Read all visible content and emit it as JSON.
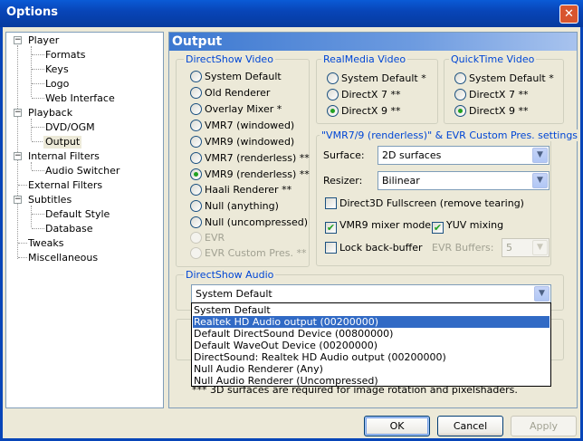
{
  "window": {
    "title": "Options",
    "close_glyph": "✕"
  },
  "tree": {
    "items": [
      {
        "label": "Player",
        "expanded": true
      },
      {
        "label": "Formats"
      },
      {
        "label": "Keys"
      },
      {
        "label": "Logo"
      },
      {
        "label": "Web Interface"
      },
      {
        "label": "Playback",
        "expanded": true
      },
      {
        "label": "DVD/OGM"
      },
      {
        "label": "Output",
        "selected": true
      },
      {
        "label": "Internal Filters",
        "expanded": true
      },
      {
        "label": "Audio Switcher"
      },
      {
        "label": "External Filters"
      },
      {
        "label": "Subtitles",
        "expanded": true
      },
      {
        "label": "Default Style"
      },
      {
        "label": "Database"
      },
      {
        "label": "Tweaks"
      },
      {
        "label": "Miscellaneous"
      }
    ],
    "expander_glyph": "−"
  },
  "panel": {
    "title": "Output"
  },
  "directshow_video": {
    "title": "DirectShow Video",
    "options": [
      "System Default",
      "Old Renderer",
      "Overlay Mixer *",
      "VMR7 (windowed)",
      "VMR9 (windowed)",
      "VMR7 (renderless) **",
      "VMR9 (renderless) **",
      "Haali Renderer **",
      "Null (anything)",
      "Null (uncompressed)",
      "EVR",
      "EVR Custom Pres. **"
    ],
    "selected": "VMR9 (renderless) **"
  },
  "realmedia_video": {
    "title": "RealMedia Video",
    "options": [
      "System Default *",
      "DirectX 7 **",
      "DirectX 9 **"
    ],
    "selected": "DirectX 9 **"
  },
  "quicktime_video": {
    "title": "QuickTime Video",
    "options": [
      "System Default *",
      "DirectX 7 **",
      "DirectX 9 **"
    ],
    "selected": "DirectX 9 **"
  },
  "vmr_settings": {
    "title": "\"VMR7/9 (renderless)\" & EVR Custom Pres. settings",
    "surface_label": "Surface:",
    "surface_value": "2D surfaces",
    "resizer_label": "Resizer:",
    "resizer_value": "Bilinear",
    "d3d_fullscreen_label": "Direct3D Fullscreen (remove tearing)",
    "d3d_fullscreen_checked": false,
    "vmr9_mixer_label": "VMR9 mixer mode",
    "vmr9_mixer_checked": true,
    "yuv_mixing_label": "YUV mixing",
    "yuv_mixing_checked": true,
    "lock_backbuffer_label": "Lock back-buffer",
    "lock_backbuffer_checked": false,
    "evr_buffers_label": "EVR Buffers:",
    "evr_buffers_value": "5"
  },
  "directshow_audio": {
    "title": "DirectShow Audio",
    "selected": "System Default",
    "options": [
      "System Default",
      "Realtek HD Audio output (00200000)",
      "Default DirectSound Device (00800000)",
      "Default WaveOut Device (00200000)",
      "DirectSound: Realtek HD Audio output (00200000)",
      "Null Audio Renderer (Any)",
      "Null Audio Renderer (Uncompressed)"
    ],
    "highlighted": "Realtek HD Audio output (00200000)"
  },
  "footnote": "*** 3D surfaces are required for image rotation and pixelshaders.",
  "buttons": {
    "ok": "OK",
    "cancel": "Cancel",
    "apply": "Apply"
  },
  "icons": {
    "combo_arrow": "▼",
    "check_mark": "✔"
  },
  "colors": {
    "titlebar": "#0845b8",
    "group_title": "#0046d5",
    "selection": "#316ac5",
    "check": "#21a121"
  }
}
